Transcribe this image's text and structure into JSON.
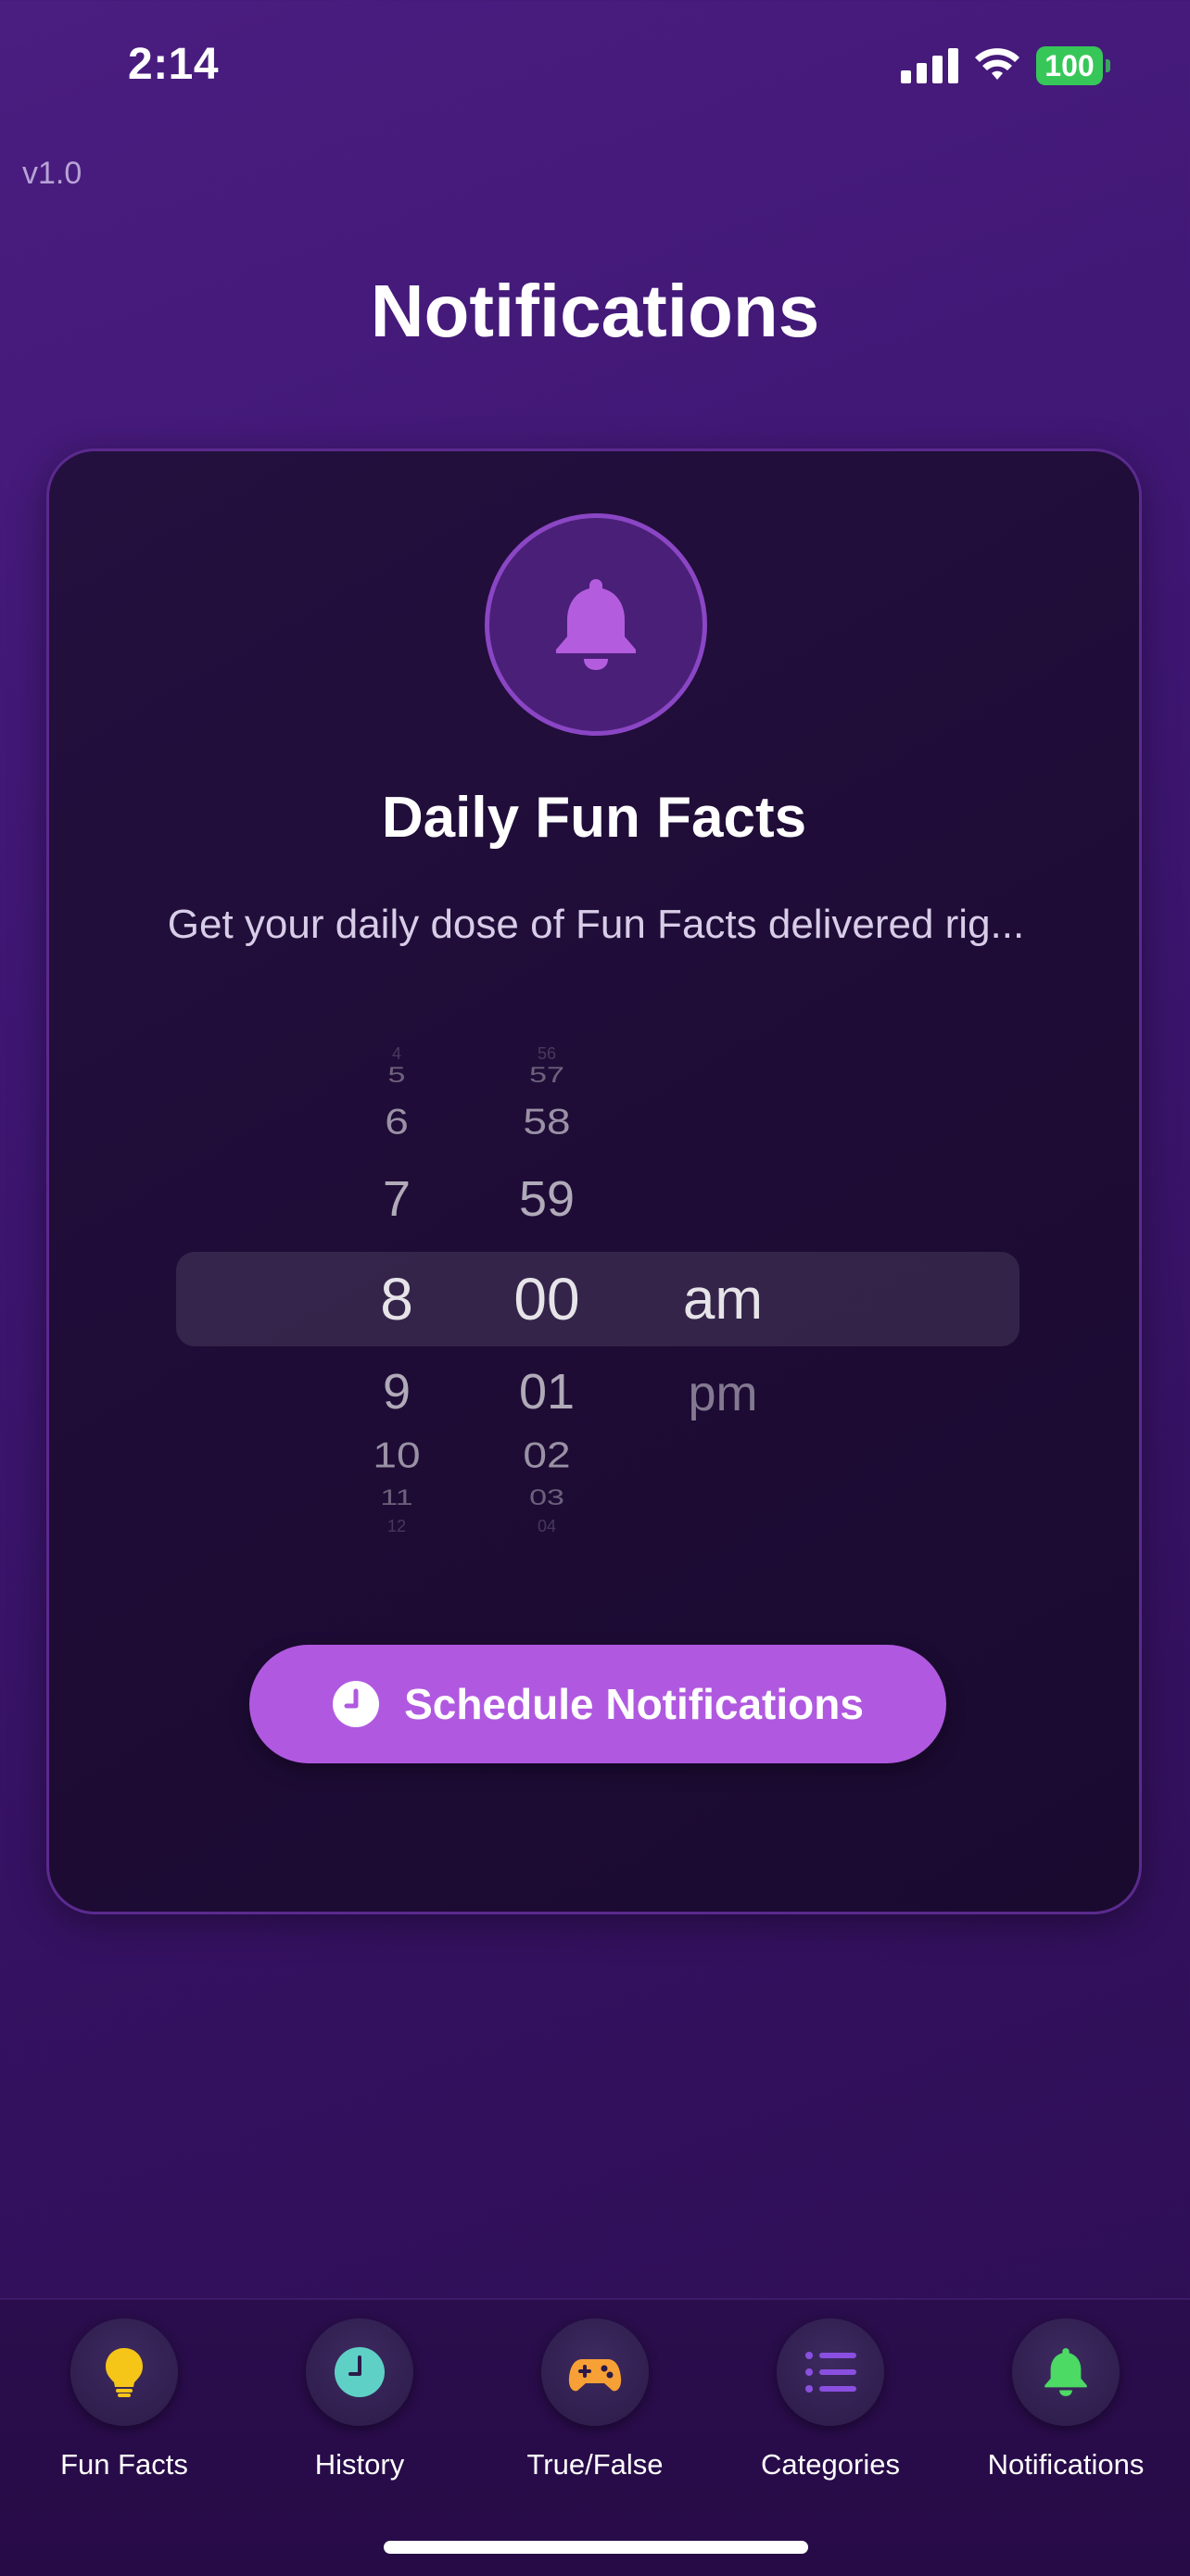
{
  "status_bar": {
    "time": "2:14",
    "battery": "100"
  },
  "version": "v1.0",
  "page": {
    "title": "Notifications"
  },
  "card": {
    "title": "Daily Fun Facts",
    "description": "Get your daily dose of Fun Facts delivered rig..."
  },
  "picker": {
    "hours": [
      "4",
      "5",
      "6",
      "7",
      "8",
      "9",
      "10",
      "11",
      "12"
    ],
    "minutes": [
      "56",
      "57",
      "58",
      "59",
      "00",
      "01",
      "02",
      "03",
      "04"
    ],
    "periods": [
      "am",
      "pm"
    ],
    "selected": {
      "hour": "8",
      "minute": "00",
      "period": "am"
    }
  },
  "schedule_button": {
    "label": "Schedule Notifications"
  },
  "tabs": [
    {
      "label": "Fun Facts",
      "icon": "lightbulb-icon",
      "color": "#f5c518"
    },
    {
      "label": "History",
      "icon": "clock-icon",
      "color": "#5fd0c6"
    },
    {
      "label": "True/False",
      "icon": "gamepad-icon",
      "color": "#f7a035"
    },
    {
      "label": "Categories",
      "icon": "list-icon",
      "color": "#8a4fe0"
    },
    {
      "label": "Notifications",
      "icon": "bell-icon",
      "color": "#4cd964"
    }
  ],
  "colors": {
    "accent": "#b059e0",
    "bell": "#b45cde"
  }
}
